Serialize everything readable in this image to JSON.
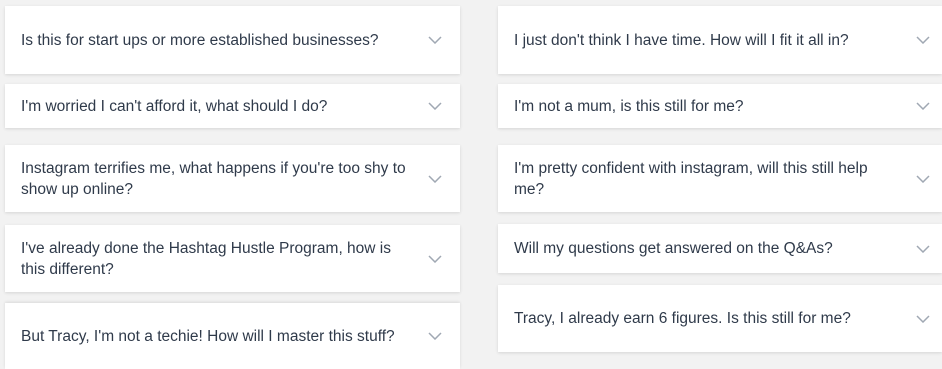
{
  "faq": {
    "left": [
      {
        "question": "Is this for start ups or more established businesses?"
      },
      {
        "question": "I'm worried I can't afford it, what should I do?"
      },
      {
        "question": "Instagram terrifies me, what happens if you're too shy to show up online?"
      },
      {
        "question": "I've already done the Hashtag Hustle Program, how is this different?"
      },
      {
        "question": "But Tracy, I'm not a techie! How will I master this stuff?"
      }
    ],
    "right": [
      {
        "question": "I just don't think I have time. How will I fit it all in?"
      },
      {
        "question": "I'm not a mum, is this still for me?"
      },
      {
        "question": "I'm pretty confident with instagram, will this still help me?"
      },
      {
        "question": "Will my questions get answered on the Q&As?"
      },
      {
        "question": "Tracy, I already earn 6 figures. Is this still for me?"
      }
    ]
  },
  "icons": {
    "expand": "chevron-down-icon",
    "chevron_color": "#a0a8b3"
  }
}
